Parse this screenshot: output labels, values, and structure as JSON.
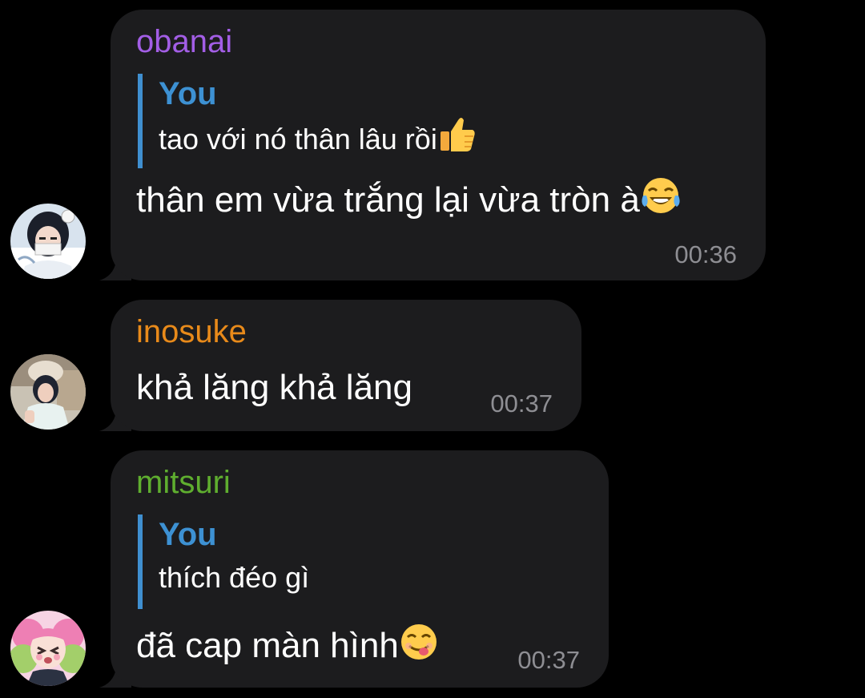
{
  "colors": {
    "background": "#000000",
    "bubble": "#1c1c1e",
    "reply_bar": "#3f8fd0",
    "reply_author": "#3d91d3",
    "timestamp": "#8e8e93"
  },
  "messages": [
    {
      "sender": "obanai",
      "sender_color": "#a35ee6",
      "reply": {
        "author": "You",
        "text": "tao với nó thân lâu rồi",
        "emoji": "thumbs-up-emoji"
      },
      "text": "thân em vừa trắng lại vừa tròn à",
      "emoji": "tears-of-joy-emoji",
      "time": "00:36",
      "avatar": "avatar-obanai"
    },
    {
      "sender": "inosuke",
      "sender_color": "#e88a1a",
      "text": "khả lăng khả lăng",
      "time": "00:37",
      "avatar": "avatar-inosuke"
    },
    {
      "sender": "mitsuri",
      "sender_color": "#5fae2f",
      "reply": {
        "author": "You",
        "text": "thích đéo gì"
      },
      "text": "đã cap màn hình",
      "emoji": "savoring-food-emoji",
      "time": "00:37",
      "avatar": "avatar-mitsuri"
    }
  ]
}
